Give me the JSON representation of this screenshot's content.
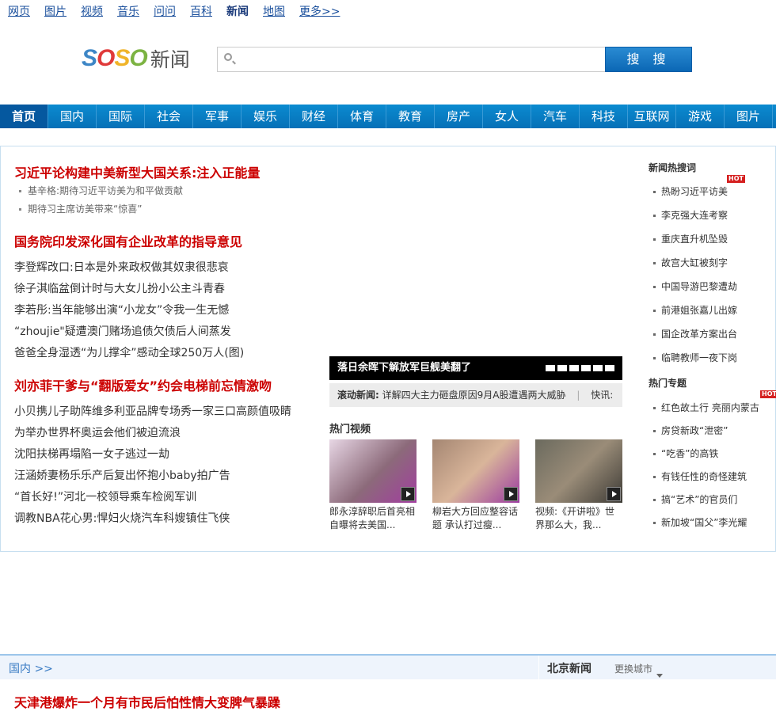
{
  "topnav": [
    "网页",
    "图片",
    "视频",
    "音乐",
    "问问",
    "百科",
    "新闻",
    "地图",
    "更多>>"
  ],
  "logo": {
    "brand": "SOSO",
    "suffix": "新闻"
  },
  "search": {
    "value": "",
    "button": "搜 搜"
  },
  "nav": [
    "首页",
    "国内",
    "国际",
    "社会",
    "军事",
    "娱乐",
    "财经",
    "体育",
    "教育",
    "房产",
    "女人",
    "汽车",
    "科技",
    "互联网",
    "游戏",
    "图片"
  ],
  "headline1": {
    "title": "习近平论构建中美新型大国关系:注入正能量",
    "subs": [
      "基辛格:期待习近平访美为和平做贡献",
      "期待习主席访美带来“惊喜”"
    ]
  },
  "headline2": {
    "title": "国务院印发深化国有企业改革的指导意见",
    "items": [
      "李登辉改口:日本是外来政权做其奴隶很悲哀",
      "徐子淇临盆倒计时与大女儿扮小公主斗青春",
      "李若彤:当年能够出演“小龙女”令我一生无憾",
      "“zhoujie\"疑遭澳门赌场追债欠债后人间蒸发",
      "爸爸全身湿透“为儿撑伞”感动全球250万人(图)"
    ]
  },
  "headline3": {
    "title": "刘亦菲干爹与“翻版爱女”约会电梯前忘情激吻",
    "items": [
      "小贝携儿子助阵维多利亚品牌专场秀一家三口高颜值吸睛",
      "为举办世界杯奥运会他们被迫流浪",
      "沈阳扶梯再塌陷一女子逃过一劫",
      "汪涵娇妻杨乐乐产后复出怀抱小baby拍广告",
      "“首长好!”河北一校领导乘车检阅军训",
      "调教NBA花心男:悍妇火烧汽车科嫂镇住飞侠"
    ]
  },
  "banner": "落日余晖下解放军巨舰美翻了",
  "scroll": {
    "label": "滚动新闻:",
    "text": "详解四大主力砸盘原因9月A股遭遇两大威胁",
    "sep": "|",
    "next": "快讯:"
  },
  "videos": {
    "title": "热门视频",
    "items": [
      "郎永淳辞职后首亮相自曝将去美国...",
      "柳岩大方回应整容话题 承认打过瘦...",
      "视频:《开讲啦》世界那么大，我..."
    ]
  },
  "hotwords": {
    "title": "新闻热搜词",
    "items": [
      "热盼习近平访美",
      "李克强大连考察",
      "重庆直升机坠毁",
      "故宫大缸被刻字",
      "中国导游巴黎遭劫",
      "前港姐张嘉儿出嫁",
      "国企改革方案出台",
      "临聘教师一夜下岗"
    ]
  },
  "topics": {
    "title": "热门专题",
    "items": [
      "红色故土行 亮丽内蒙古",
      "房贷新政“泄密”",
      "“吃香”的高铁",
      "有钱任性的奇怪建筑",
      "搞“艺术”的官员们",
      "新加坡“国父”李光耀"
    ]
  },
  "hot_badge": "HOT",
  "bottom": {
    "section": "国内 >>",
    "city_title": "北京新闻",
    "change_city": "更换城市",
    "headline": "天津港爆炸一个月有市民后怕性情大变脾气暴躁"
  },
  "colors": {
    "accent": "#0670b7",
    "headline": "#cc0000"
  }
}
